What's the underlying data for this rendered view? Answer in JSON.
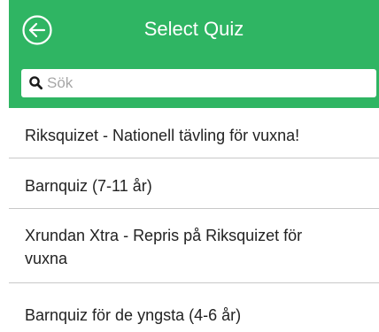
{
  "header": {
    "title": "Select Quiz",
    "back_icon": "arrow-left-circle-icon",
    "accent_color": "#2fb563"
  },
  "search": {
    "placeholder": "Sök",
    "value": "",
    "icon": "search-icon"
  },
  "quizzes": [
    {
      "label": "Riksquizet - Nationell tävling för vuxna!"
    },
    {
      "label": "Barnquiz (7-11 år)"
    },
    {
      "label": "Xrundan Xtra - Repris på Riksquizet för vuxna"
    },
    {
      "label": "Barnquiz för de yngsta (4-6 år)"
    }
  ]
}
